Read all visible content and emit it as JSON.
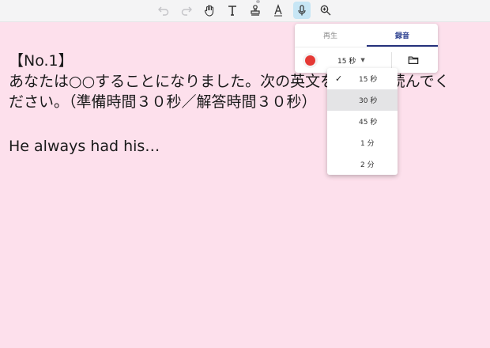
{
  "toolbar": {
    "tools": [
      {
        "name": "undo-icon",
        "active": false
      },
      {
        "name": "redo-icon",
        "active": false
      },
      {
        "name": "hand-icon",
        "active": false
      },
      {
        "name": "text-icon",
        "active": false
      },
      {
        "name": "stamp-icon",
        "active": false
      },
      {
        "name": "pen-icon",
        "active": false
      },
      {
        "name": "microphone-icon",
        "active": true
      },
      {
        "name": "zoom-icon",
        "active": false
      }
    ]
  },
  "document": {
    "line1": "【No.1】",
    "line2": "あなたは○○することになりました。次の英文を",
    "line2_tail": "して読んでく",
    "line3": "ださい。（準備時間３０秒／解答時間３０秒）",
    "line4": "He always had his…"
  },
  "recorder": {
    "tab_play": "再生",
    "tab_record": "録音",
    "active_tab": "録音",
    "duration_value": "15 秒",
    "accent_color": "#26327d",
    "record_color": "#e53935"
  },
  "duration_menu": {
    "options": [
      "15 秒",
      "30 秒",
      "45 秒",
      "1 分",
      "2 分"
    ],
    "selected": "15 秒",
    "hovered": "30 秒"
  }
}
